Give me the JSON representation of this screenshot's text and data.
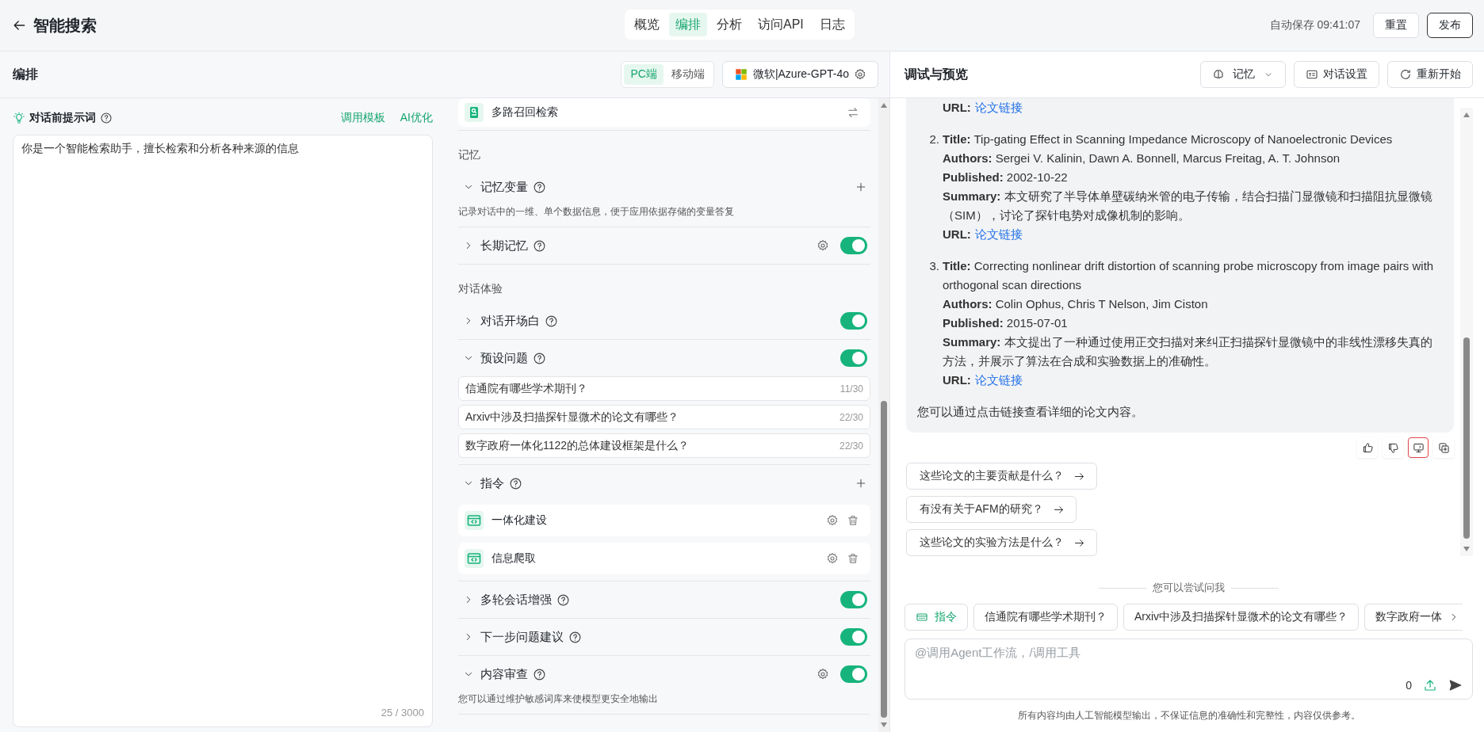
{
  "header": {
    "title": "智能搜索",
    "tabs": [
      {
        "label": "概览",
        "selected": false
      },
      {
        "label": "编排",
        "selected": true
      },
      {
        "label": "分析",
        "selected": false
      },
      {
        "label": "访问API",
        "selected": false
      },
      {
        "label": "日志",
        "selected": false
      }
    ],
    "autosave": "自动保存 09:41:07",
    "buttons": [
      {
        "label": "重置",
        "kind": "default"
      },
      {
        "label": "发布",
        "kind": "strong"
      }
    ]
  },
  "editor": {
    "title": "编排",
    "device_tabs": [
      {
        "label": "PC端",
        "selected": true
      },
      {
        "label": "移动端",
        "selected": false
      }
    ],
    "model": "微软|Azure-GPT-4o"
  },
  "prompt": {
    "title": "对话前提示词",
    "links": [
      "调用模板",
      "AI优化"
    ],
    "value": "你是一个智能检索助手，擅长检索和分析各种来源的信息",
    "counter": "25 / 3000"
  },
  "config": {
    "items": [
      {
        "kind": "retrieval",
        "label": "多路召回检索"
      },
      {
        "kind": "heading",
        "label": "记忆"
      },
      {
        "kind": "setting",
        "label": "记忆变量",
        "expanded": true,
        "add": true,
        "description": "记录对话中的一维、单个数据信息，便于应用依据存储的变量答复"
      },
      {
        "kind": "setting",
        "label": "长期记忆",
        "expanded": false,
        "settings": true,
        "on": true
      },
      {
        "kind": "heading",
        "label": "对话体验"
      },
      {
        "kind": "setting",
        "label": "对话开场白",
        "expanded": false,
        "on": true
      },
      {
        "kind": "setting",
        "label": "预设问题",
        "expanded": true,
        "on": true,
        "questions": [
          {
            "value": "信通院有哪些学术期刊？",
            "counter": "11/30"
          },
          {
            "value": "Arxiv中涉及扫描探针显微术的论文有哪些？",
            "counter": "22/30"
          },
          {
            "value": "数字政府一体化1122的总体建设框架是什么？",
            "counter": "22/30"
          }
        ]
      },
      {
        "kind": "setting",
        "label": "指令",
        "expanded": true,
        "add": true,
        "commands": [
          {
            "label": "一体化建设"
          },
          {
            "label": "信息爬取"
          }
        ]
      },
      {
        "kind": "setting",
        "label": "多轮会话增强",
        "expanded": false,
        "on": true
      },
      {
        "kind": "setting",
        "label": "下一步问题建议",
        "expanded": false,
        "on": true
      },
      {
        "kind": "setting",
        "label": "内容审查",
        "expanded": true,
        "settings": true,
        "on": true,
        "description": "您可以通过维护敏感词库来使模型更安全地输出"
      }
    ]
  },
  "preview": {
    "title": "调试与预览",
    "buttons": [
      {
        "label": "记忆",
        "kind": "memory"
      },
      {
        "label": "对话设置",
        "kind": "settings"
      },
      {
        "label": "重新开始",
        "kind": "restart"
      }
    ],
    "message": {
      "papers": [
        {
          "fields": [
            {
              "kind": "link",
              "label": "URL:",
              "link": "论文链接"
            }
          ]
        },
        {
          "number": "2.",
          "fields": [
            {
              "kind": "text",
              "text": "**Title:** Tip-gating Effect in Scanning Impedance Microscopy of Nanoelectronic Devices"
            },
            {
              "kind": "text",
              "text": "**Authors:** Sergei V. Kalinin, Dawn A. Bonnell, Marcus Freitag, A. T. Johnson"
            },
            {
              "kind": "text",
              "text": "**Published:** 2002-10-22"
            },
            {
              "kind": "text",
              "text": "**Summary:** 本文研究了半导体单壁碳纳米管的电子传输，结合扫描门显微镜和扫描阻抗显微镜（SIM），讨论了探针电势对成像机制的影响。"
            },
            {
              "kind": "link",
              "label": "URL:",
              "link": "论文链接"
            }
          ]
        },
        {
          "number": "3.",
          "fields": [
            {
              "kind": "text",
              "text": "**Title:** Correcting nonlinear drift distortion of scanning probe microscopy from image pairs with orthogonal scan directions"
            },
            {
              "kind": "text",
              "text": "**Authors:** Colin Ophus, Chris T Nelson, Jim Ciston"
            },
            {
              "kind": "text",
              "text": "**Published:** 2015-07-01"
            },
            {
              "kind": "text",
              "text": "**Summary:** 本文提出了一种通过使用正交扫描对来纠正扫描探针显微镜中的非线性漂移失真的方法，并展示了算法在合成和实验数据上的准确性。"
            },
            {
              "kind": "link",
              "label": "URL:",
              "link": "论文链接"
            }
          ]
        }
      ],
      "closing": "您可以通过点击链接查看详细的论文内容。"
    },
    "actions": [
      {
        "kind": "like",
        "selected": false
      },
      {
        "kind": "dislike",
        "selected": false
      },
      {
        "kind": "screen",
        "selected": true
      },
      {
        "kind": "copy",
        "selected": false
      }
    ],
    "suggestions": [
      "这些论文的主要贡献是什么？",
      "有没有关于AFM的研究？",
      "这些论文的实验方法是什么？"
    ],
    "try_ask": {
      "label": "您可以尝试问我",
      "chips": [
        {
          "kind": "command",
          "label": "指令"
        },
        {
          "kind": "question",
          "label": "信通院有哪些学术期刊？"
        },
        {
          "kind": "question",
          "label": "Arxiv中涉及扫描探针显微术的论文有哪些？"
        },
        {
          "kind": "question",
          "label": "数字政府一体"
        }
      ]
    },
    "input": {
      "placeholder": "@调用Agent工作流，/调用工具",
      "count": "0"
    },
    "disclaimer": "所有内容均由人工智能模型输出，不保证信息的准确性和完整性，内容仅供参考。"
  }
}
